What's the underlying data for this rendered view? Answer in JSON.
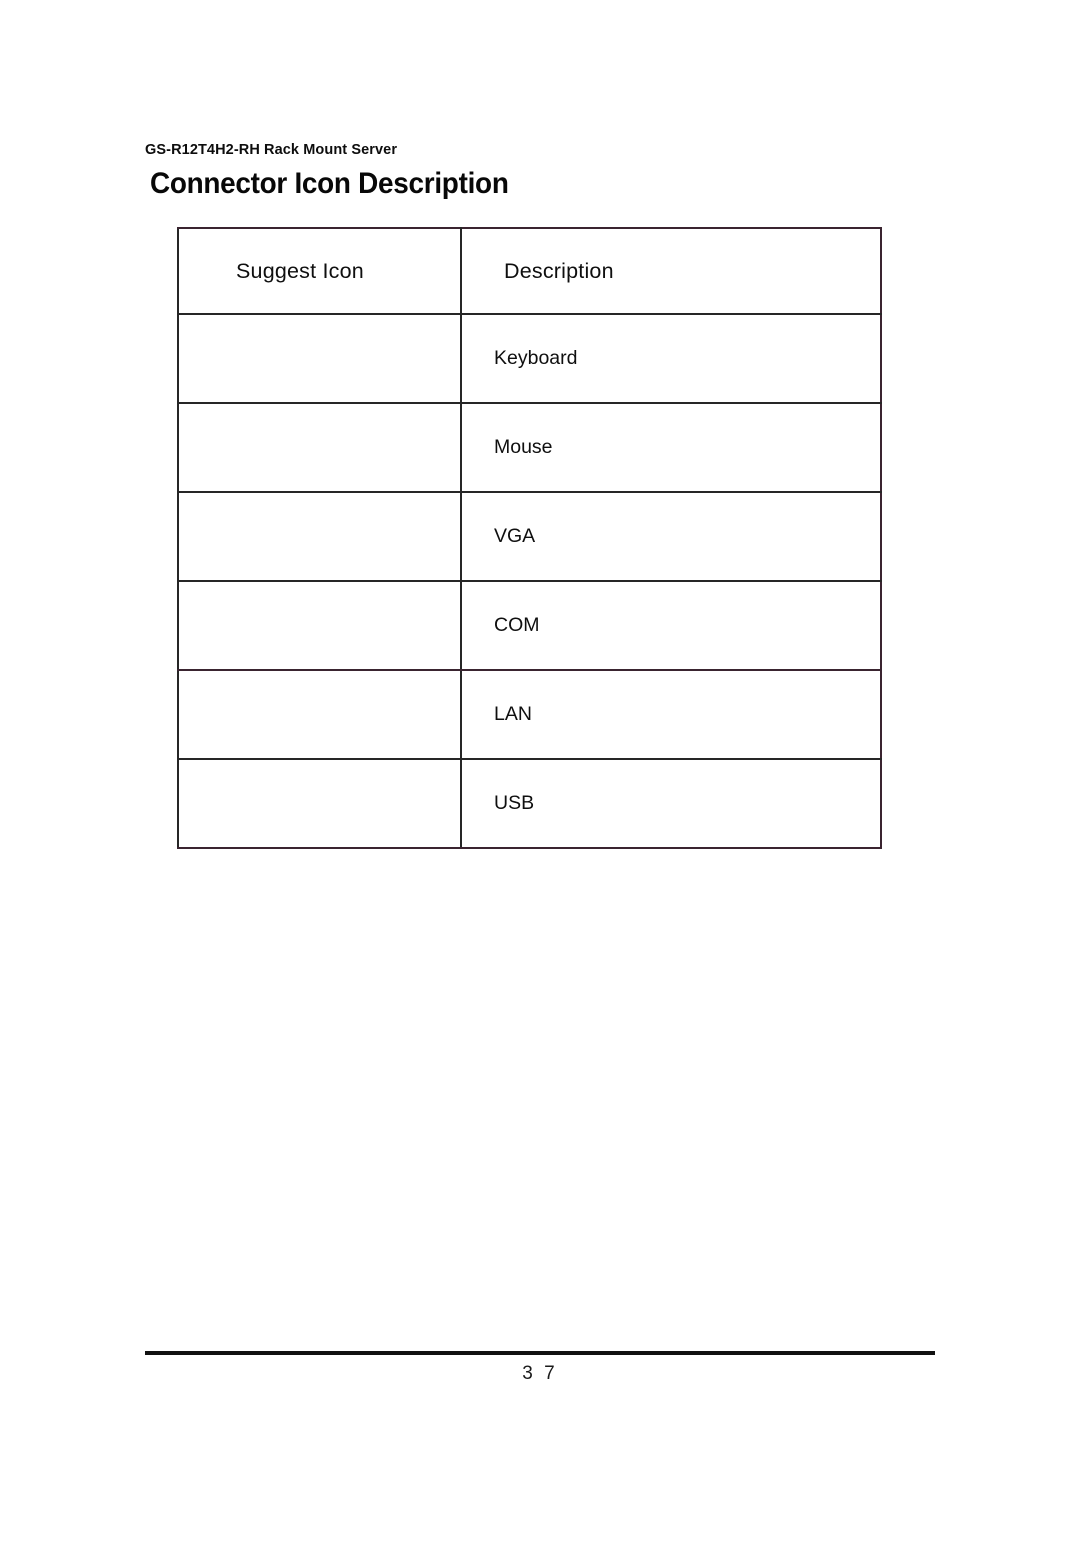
{
  "document": {
    "running_header": "GS-R12T4H2-RH Rack Mount Server",
    "title": "Connector Icon Description",
    "page_number": "3 7"
  },
  "table": {
    "columns": [
      {
        "key": "icon",
        "label": "Suggest Icon"
      },
      {
        "key": "description",
        "label": "Description"
      }
    ],
    "rows": [
      {
        "icon": "",
        "icon_name": "keyboard-connector-icon",
        "description": "Keyboard"
      },
      {
        "icon": "",
        "icon_name": "mouse-connector-icon",
        "description": "Mouse"
      },
      {
        "icon": "",
        "icon_name": "vga-connector-icon",
        "description": "VGA"
      },
      {
        "icon": "",
        "icon_name": "com-connector-icon",
        "description": "COM"
      },
      {
        "icon": "",
        "icon_name": "lan-connector-icon",
        "description": "LAN"
      },
      {
        "icon": "",
        "icon_name": "usb-connector-icon",
        "description": "USB"
      }
    ]
  },
  "colors": {
    "text": "#111111",
    "border": "#262626",
    "border_tinted": "#3a2430",
    "background": "#ffffff"
  }
}
